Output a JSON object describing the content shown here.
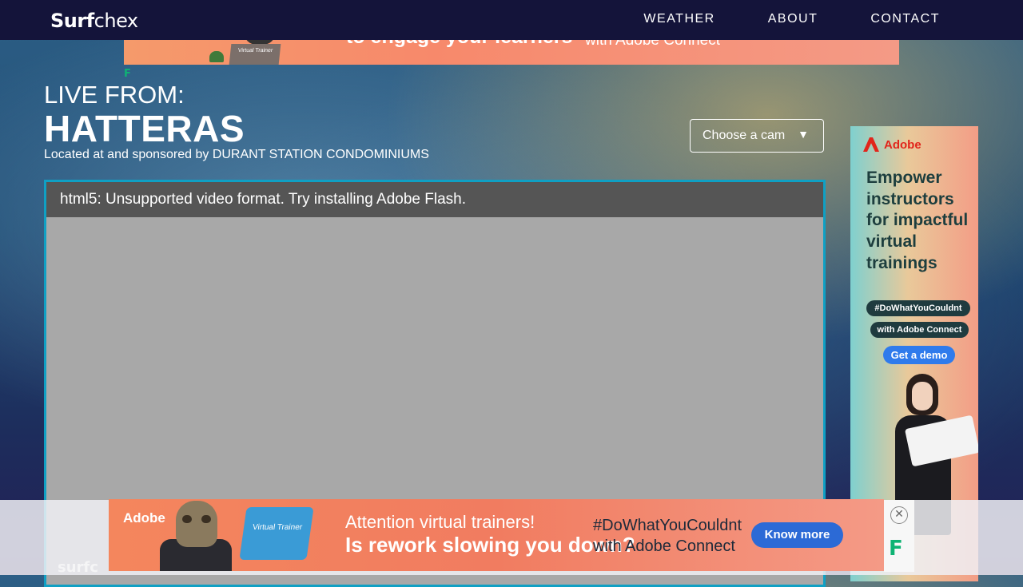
{
  "nav": {
    "logo_bold": "Surf",
    "logo_light": "chex",
    "links": [
      "WEATHER",
      "ABOUT",
      "CONTACT"
    ]
  },
  "top_ad": {
    "headline": "to engage your learners",
    "subline": "with Adobe Connect",
    "laptop_label": "Virtual Trainer"
  },
  "freestar_mark": "F",
  "headline": {
    "live_from": "LIVE FROM:",
    "location": "HATTERAS",
    "sponsor": "Located at and sponsored by DURANT STATION CONDOMINIUMS"
  },
  "cam_select": {
    "label": "Choose a cam",
    "arrow": "▼"
  },
  "player": {
    "message": "html5: Unsupported video format. Try installing Adobe Flash."
  },
  "side_ad": {
    "brand": "Adobe",
    "headline": "Empower instructors for impactful virtual trainings",
    "pill1": "#DoWhatYouCouldnt",
    "pill2": "with Adobe Connect",
    "cta": "Get a demo"
  },
  "bottom_ad": {
    "brand": "Adobe",
    "line1": "Attention virtual trainers!",
    "line2": "Is rework slowing you down?",
    "line3": "#DoWhatYouCouldnt",
    "line4": "with Adobe Connect",
    "cta": "Know more",
    "laptop_label": "Virtual Trainer",
    "close": "✕"
  },
  "footer_logo": "surfc"
}
